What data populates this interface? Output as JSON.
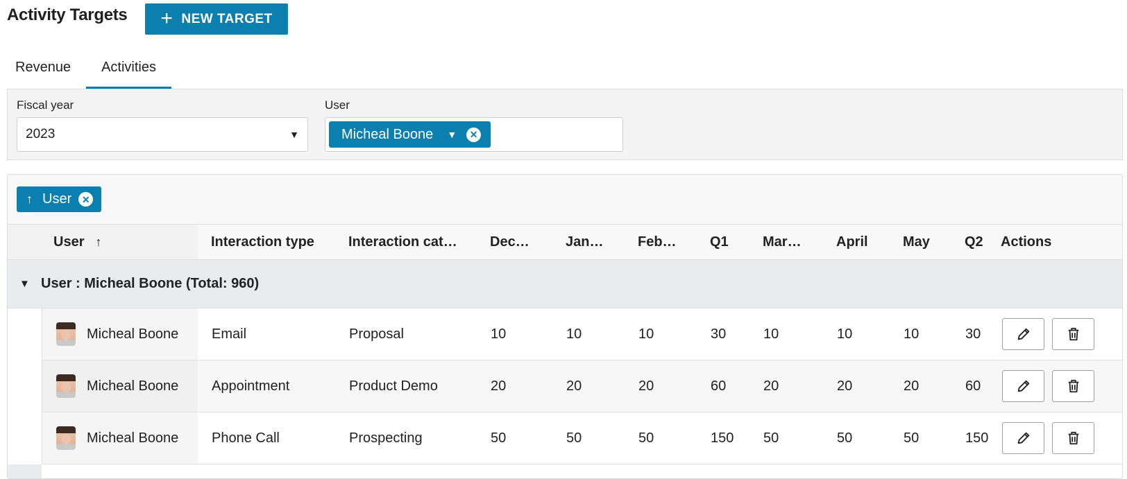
{
  "header": {
    "title": "Activity Targets",
    "new_target_label": "NEW TARGET"
  },
  "tabs": [
    {
      "label": "Revenue",
      "active": false
    },
    {
      "label": "Activities",
      "active": true
    }
  ],
  "filters": {
    "fiscal_year": {
      "label": "Fiscal year",
      "value": "2023"
    },
    "user": {
      "label": "User",
      "chip": "Micheal Boone"
    }
  },
  "grouping": {
    "chip_label": "User"
  },
  "columns": {
    "user": "User",
    "interaction_type": "Interaction type",
    "interaction_category": "Interaction cat…",
    "dec": "Dec…",
    "jan": "Jan…",
    "feb": "Feb…",
    "q1": "Q1",
    "mar": "Mar…",
    "april": "April",
    "may": "May",
    "q2": "Q2",
    "actions": "Actions"
  },
  "group": {
    "title": "User : Micheal Boone (Total: 960)"
  },
  "rows": [
    {
      "user": "Micheal Boone",
      "type": "Email",
      "category": "Proposal",
      "dec": "10",
      "jan": "10",
      "feb": "10",
      "q1": "30",
      "mar": "10",
      "april": "10",
      "may": "10",
      "q2": "30"
    },
    {
      "user": "Micheal Boone",
      "type": "Appointment",
      "category": "Product Demo",
      "dec": "20",
      "jan": "20",
      "feb": "20",
      "q1": "60",
      "mar": "20",
      "april": "20",
      "may": "20",
      "q2": "60"
    },
    {
      "user": "Micheal Boone",
      "type": "Phone Call",
      "category": "Prospecting",
      "dec": "50",
      "jan": "50",
      "feb": "50",
      "q1": "150",
      "mar": "50",
      "april": "50",
      "may": "50",
      "q2": "150"
    }
  ],
  "colors": {
    "accent": "#0b7fae"
  },
  "icons": {
    "plus": "plus-icon",
    "dropdown": "caret-down-icon",
    "clear": "clear-circle-icon",
    "sort": "arrow-up-icon",
    "expand": "triangle-down-icon",
    "edit": "pencil-icon",
    "delete": "trash-icon"
  }
}
